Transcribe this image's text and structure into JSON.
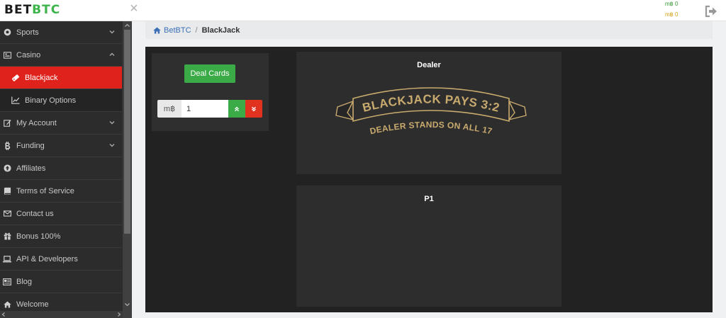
{
  "header": {
    "logo_main": "BET",
    "logo_accent": "BTC",
    "close_glyph": "×",
    "balance_primary": "m฿ 0",
    "balance_secondary": "m฿ 0",
    "logout_icon": "logout-icon"
  },
  "sidebar": {
    "items": [
      {
        "label": "Sports",
        "icon": "soccer-ball-icon",
        "chevron": "down"
      },
      {
        "label": "Casino",
        "icon": "cards-icon",
        "chevron": "up"
      },
      {
        "label": "Blackjack",
        "icon": "ticket-icon",
        "active": true,
        "sub": true
      },
      {
        "label": "Binary Options",
        "icon": "line-chart-icon",
        "sub": true
      },
      {
        "label": "My Account",
        "icon": "edit-icon",
        "chevron": "down"
      },
      {
        "label": "Funding",
        "icon": "bitcoin-icon",
        "chevron": "down"
      },
      {
        "label": "Affiliates",
        "icon": "arrow-circle-icon"
      },
      {
        "label": "Terms of Service",
        "icon": "book-icon"
      },
      {
        "label": "Contact us",
        "icon": "envelope-icon"
      },
      {
        "label": "Bonus 100%",
        "icon": "gift-icon"
      },
      {
        "label": "API & Developers",
        "icon": "laptop-icon"
      },
      {
        "label": "Blog",
        "icon": "newspaper-icon"
      },
      {
        "label": "Welcome",
        "icon": "home-icon"
      }
    ]
  },
  "breadcrumb": {
    "home_label": "BetBTC",
    "separator": "/",
    "current": "BlackJack"
  },
  "game": {
    "deal_label": "Deal Cards",
    "bet_unit": "m฿",
    "bet_value": "1",
    "dealer_title": "Dealer",
    "player_title": "P1",
    "banner_top": "BLACKJACK PAYS 3:2",
    "banner_bottom": "DEALER STANDS ON ALL 17"
  },
  "colors": {
    "accent_green": "#3aab46",
    "accent_red": "#e0221c",
    "gold": "#c8aa6e",
    "sidebar_bg": "#2c2c2c",
    "table_bg": "#222222"
  }
}
